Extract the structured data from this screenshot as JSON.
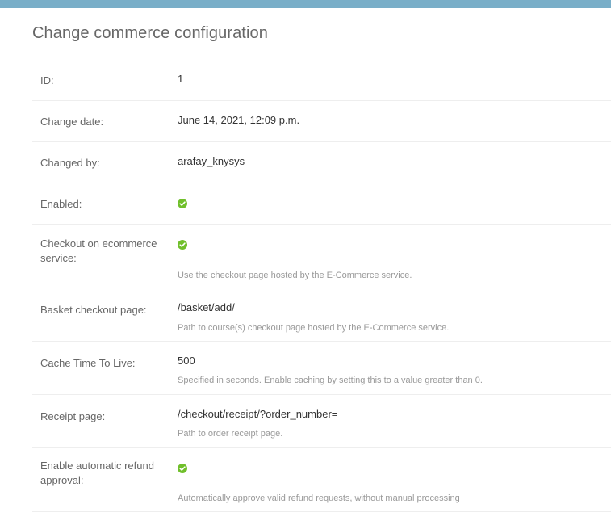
{
  "page": {
    "title": "Change commerce configuration"
  },
  "theme": {
    "header_color": "#79aec8",
    "yes_icon_color": "#70bf2b"
  },
  "fields": {
    "id": {
      "label": "ID:",
      "value": "1"
    },
    "change_date": {
      "label": "Change date:",
      "value": "June 14, 2021, 12:09 p.m."
    },
    "changed_by": {
      "label": "Changed by:",
      "value": "arafay_knysys"
    },
    "enabled": {
      "label": "Enabled:",
      "icon": "yes-icon"
    },
    "checkout_on_ecommerce": {
      "label": "Checkout on ecommerce service:",
      "icon": "yes-icon",
      "help": "Use the checkout page hosted by the E-Commerce service."
    },
    "basket_checkout_page": {
      "label": "Basket checkout page:",
      "value": "/basket/add/",
      "help": "Path to course(s) checkout page hosted by the E-Commerce service."
    },
    "cache_ttl": {
      "label": "Cache Time To Live:",
      "value": "500",
      "help": "Specified in seconds. Enable caching by setting this to a value greater than 0."
    },
    "receipt_page": {
      "label": "Receipt page:",
      "value": "/checkout/receipt/?order_number=",
      "help": "Path to order receipt page."
    },
    "auto_refund": {
      "label": "Enable automatic refund approval:",
      "icon": "yes-icon",
      "help": "Automatically approve valid refund requests, without manual processing"
    }
  }
}
